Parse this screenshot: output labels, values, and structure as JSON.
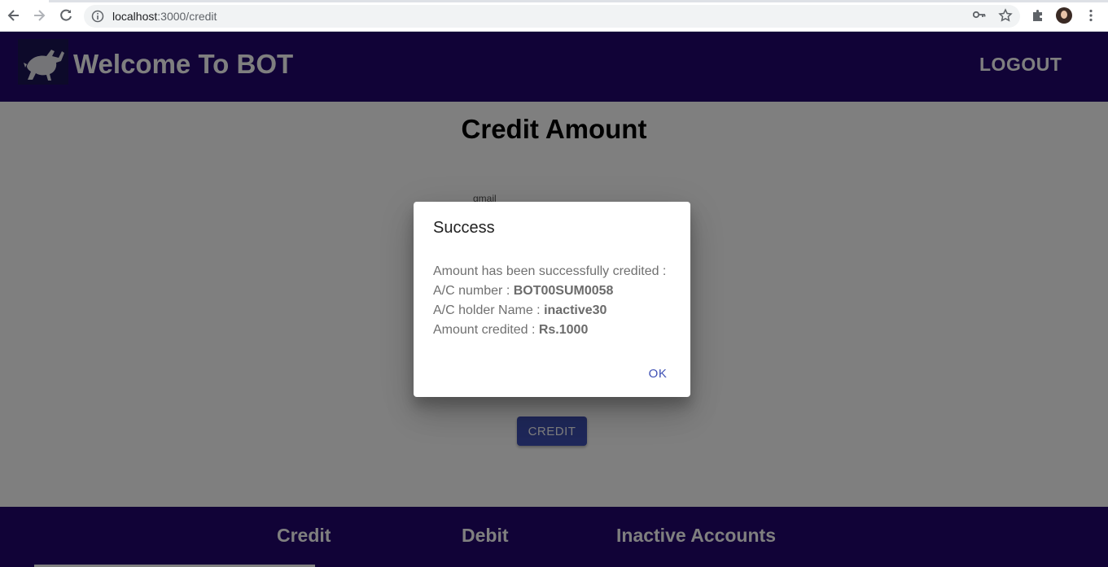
{
  "browser": {
    "url_host": "localhost",
    "url_path": ":3000/credit",
    "icons": [
      "back-arrow-icon",
      "forward-arrow-icon",
      "reload-icon",
      "info-icon",
      "key-icon",
      "star-icon",
      "puzzle-icon",
      "avatar",
      "more-vert-icon"
    ]
  },
  "header": {
    "title": "Welcome To BOT",
    "logout_label": "LOGOUT",
    "bg_color": "#22066f"
  },
  "main": {
    "page_title": "Credit Amount",
    "field_label": "gmail",
    "credit_button": "CREDIT"
  },
  "dialog": {
    "title": "Success",
    "line1": "Amount has been successfully credited :",
    "account_label": "A/C number : ",
    "account_value": "BOT00SUM0058",
    "holder_label": "A/C holder Name : ",
    "holder_value": "inactive30",
    "amount_label": "Amount credited : ",
    "amount_value": "Rs.1000",
    "ok_label": "OK"
  },
  "footer": {
    "links": [
      "Credit",
      "Debit",
      "Inactive Accounts"
    ]
  },
  "colors": {
    "primary": "#3f51b5",
    "header": "#22066f"
  }
}
